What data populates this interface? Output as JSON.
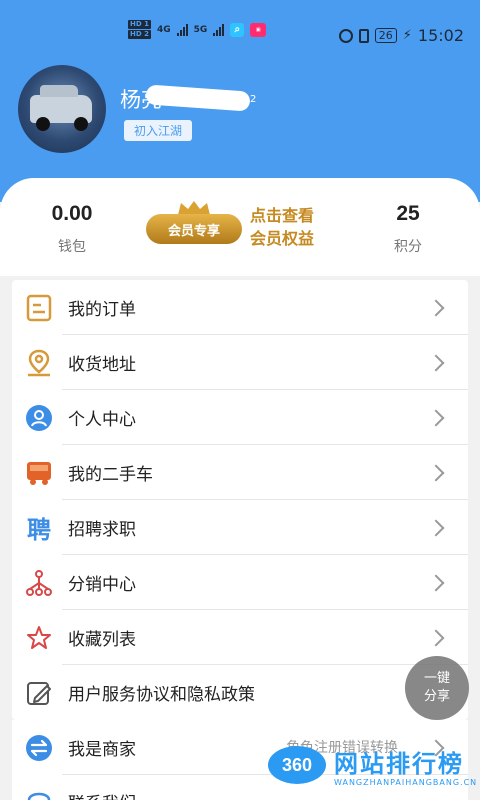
{
  "status_bar": {
    "hd1": "HD 1",
    "hd2": "HD 2",
    "net1": "4G",
    "net2": "5G",
    "battery": "26",
    "time": "15:02"
  },
  "profile": {
    "name_visible": "杨亮",
    "name_suffix": "2",
    "level": "初入江湖"
  },
  "stats": {
    "wallet_value": "0.00",
    "wallet_label": "钱包",
    "vip_badge": "会员专享",
    "vip_text_line1": "点击查看",
    "vip_text_line2": "会员权益",
    "points_value": "25",
    "points_label": "积分"
  },
  "menu": {
    "items": [
      {
        "label": "我的订单",
        "icon": "order-icon"
      },
      {
        "label": "收货地址",
        "icon": "location-icon"
      },
      {
        "label": "个人中心",
        "icon": "person-icon"
      },
      {
        "label": "我的二手车",
        "icon": "truck-icon"
      },
      {
        "label": "招聘求职",
        "icon": "recruit-icon"
      },
      {
        "label": "分销中心",
        "icon": "distribution-icon"
      },
      {
        "label": "收藏列表",
        "icon": "star-icon"
      },
      {
        "label": "用户服务协议和隐私政策",
        "icon": "edit-icon"
      }
    ],
    "recruit_glyph": "聘"
  },
  "menu2": {
    "items": [
      {
        "label": "我是商家",
        "icon": "switch-icon",
        "hint": "角色注册错误转换"
      },
      {
        "label": "联系我们",
        "icon": "headset-icon"
      }
    ]
  },
  "share_fab": {
    "line1": "一键",
    "line2": "分享"
  },
  "watermark": {
    "logo": "360",
    "title": "网站排行榜",
    "sub": "WANGZHANPAIHANGBANG.CN"
  },
  "colors": {
    "brand_blue": "#4a9cf0",
    "gold": "#c68a22"
  }
}
